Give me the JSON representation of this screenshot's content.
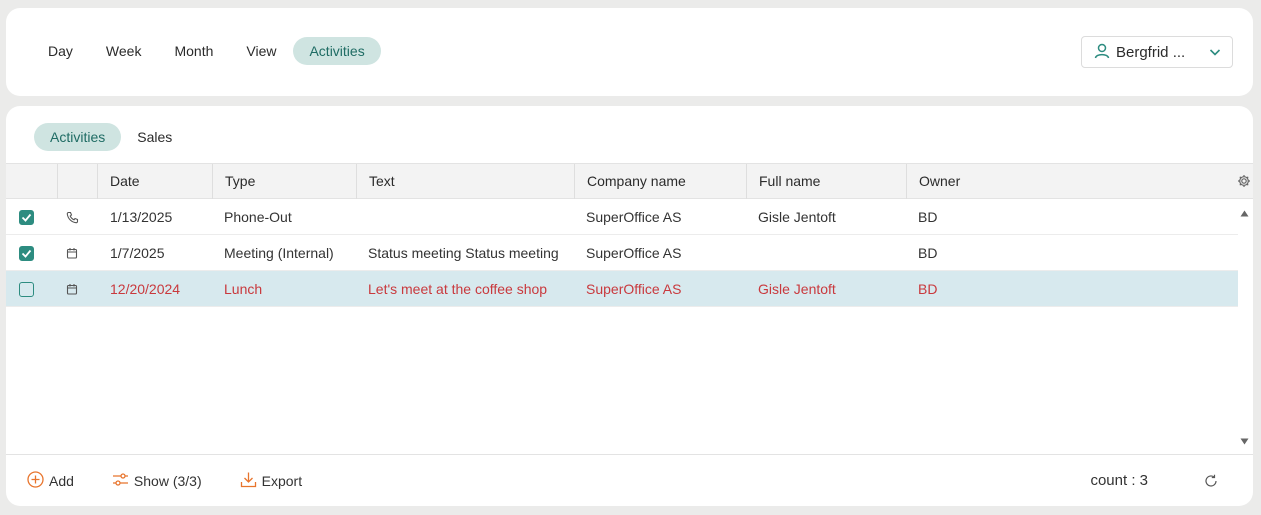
{
  "view_tabs": [
    {
      "label": "Day",
      "active": false
    },
    {
      "label": "Week",
      "active": false
    },
    {
      "label": "Month",
      "active": false
    },
    {
      "label": "View",
      "active": false
    },
    {
      "label": "Activities",
      "active": true
    }
  ],
  "user_select": {
    "value": "Bergfrid ..."
  },
  "sub_tabs": [
    {
      "label": "Activities",
      "active": true
    },
    {
      "label": "Sales",
      "active": false
    }
  ],
  "table": {
    "columns": [
      "Date",
      "Type",
      "Text",
      "Company name",
      "Full name",
      "Owner"
    ],
    "rows": [
      {
        "checked": true,
        "icon": "phone-icon",
        "date": "1/13/2025",
        "type": "Phone-Out",
        "text": "",
        "company": "SuperOffice AS",
        "full_name": "Gisle Jentoft",
        "owner": "BD",
        "selected": false
      },
      {
        "checked": true,
        "icon": "calendar-icon",
        "date": "1/7/2025",
        "type": "Meeting (Internal)",
        "text": "Status meeting Status meeting",
        "company": "SuperOffice AS",
        "full_name": "",
        "owner": "BD",
        "selected": false
      },
      {
        "checked": false,
        "icon": "calendar-icon",
        "date": "12/20/2024",
        "type": "Lunch",
        "text": "Let's meet at the coffee shop",
        "company": "SuperOffice AS",
        "full_name": "Gisle Jentoft",
        "owner": "BD",
        "selected": true
      }
    ]
  },
  "footer": {
    "add_label": "Add",
    "show_label": "Show (3/3)",
    "export_label": "Export",
    "count_label": "count : 3"
  },
  "colors": {
    "accent": "#2d8c80",
    "tab_active_bg": "#cfe4e1",
    "selected_row_bg": "#d7e9ee",
    "selected_row_text": "#c9393d",
    "footer_icon": "#e8742c"
  }
}
